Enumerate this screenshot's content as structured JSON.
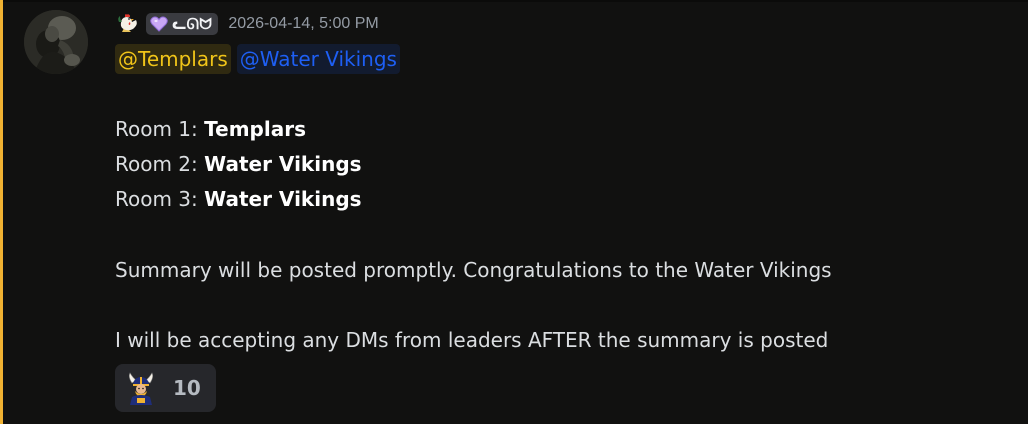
{
  "message": {
    "author_tag": "ᓚᘏᗢ",
    "timestamp": "2026-04-14, 5:00 PM",
    "mentions": [
      "@Templars",
      "@Water Vikings"
    ],
    "rooms": [
      {
        "label": "Room 1:",
        "winner": "Templars"
      },
      {
        "label": "Room 2:",
        "winner": "Water Vikings"
      },
      {
        "label": "Room 3:",
        "winner": "Water Vikings"
      }
    ],
    "summary_line": "Summary will be posted promptly. Congratulations to the Water Vikings",
    "dm_line": "I will be accepting any DMs from leaders AFTER the summary is posted",
    "reaction": {
      "emoji": "viking-emoji",
      "count": "10"
    }
  },
  "colors": {
    "accent": "#f0b232",
    "templars_mention": "#f0c419",
    "vikings_mention": "#1e5ff4",
    "background": "#111110"
  },
  "icons": {
    "author_emoji": "rooster-icon",
    "badge_icon": "purple-heart-icon"
  }
}
